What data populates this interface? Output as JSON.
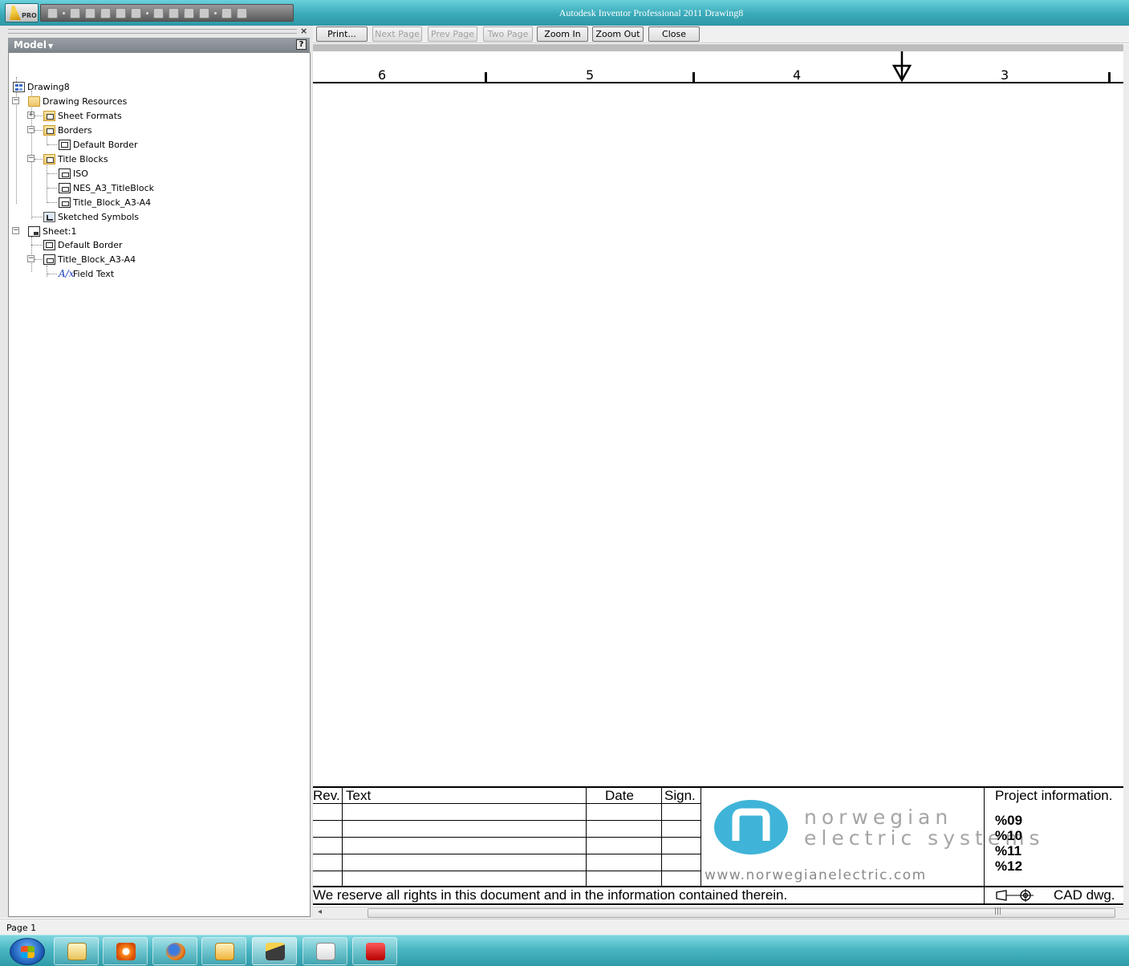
{
  "window": {
    "title": "Autodesk Inventor Professional 2011   Drawing8",
    "app_badge": "PRO"
  },
  "browser": {
    "header": "Model",
    "close_glyph": "×",
    "help_glyph": "?",
    "tree": [
      {
        "label": "Drawing8",
        "icon": "drawing-document-icon"
      },
      {
        "label": "Drawing Resources",
        "icon": "folder-icon"
      },
      {
        "label": "Sheet Formats",
        "icon": "sheet-formats-folder-icon"
      },
      {
        "label": "Borders",
        "icon": "borders-folder-icon"
      },
      {
        "label": "Default Border",
        "icon": "border-icon"
      },
      {
        "label": "Title Blocks",
        "icon": "title-blocks-folder-icon"
      },
      {
        "label": "ISO",
        "icon": "title-block-icon"
      },
      {
        "label": "NES_A3_TitleBlock",
        "icon": "title-block-icon"
      },
      {
        "label": "Title_Block_A3-A4",
        "icon": "title-block-icon"
      },
      {
        "label": "Sketched Symbols",
        "icon": "sketched-symbols-folder-icon"
      },
      {
        "label": "Sheet:1",
        "icon": "sheet-icon"
      },
      {
        "label": "Default Border",
        "icon": "border-icon"
      },
      {
        "label": "Title_Block_A3-A4",
        "icon": "title-block-icon"
      },
      {
        "label": "Field Text",
        "icon": "field-text-icon"
      }
    ]
  },
  "preview_toolbar": {
    "print": "Print...",
    "next_page": "Next Page",
    "prev_page": "Prev Page",
    "two_page": "Two Page",
    "zoom_in": "Zoom In",
    "zoom_out": "Zoom Out",
    "close": "Close"
  },
  "sheet": {
    "zones": [
      "6",
      "5",
      "4",
      "3"
    ],
    "title_block": {
      "rev_header": "Rev.",
      "text_header": "Text",
      "date_header": "Date",
      "sign_header": "Sign.",
      "brand_line1": "norwegian",
      "brand_line2": "electric systems",
      "website": "www.norwegianelectric.com",
      "project_info_label": "Project information.",
      "fields": [
        "%09",
        "%10",
        "%11",
        "%12"
      ],
      "rights_notice": "We reserve all rights in this document and in the information contained therein.",
      "cad_label": "CAD dwg."
    }
  },
  "status": {
    "page": "Page 1"
  },
  "colors": {
    "title_bar": "#3aaab9",
    "logo_blue": "#3fb4d8",
    "brand_gray": "#a5a5a5"
  }
}
